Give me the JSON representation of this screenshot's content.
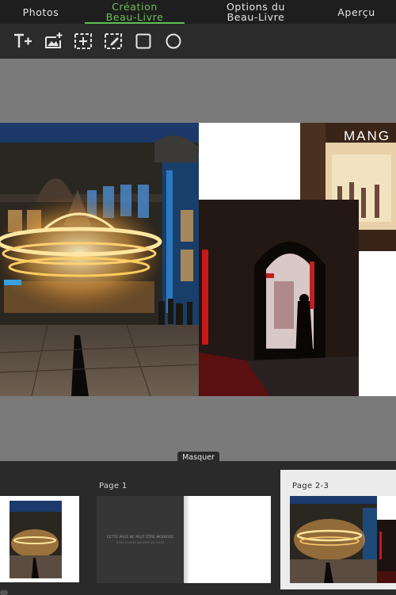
{
  "nav": {
    "tabs": [
      {
        "label": "Photos"
      },
      {
        "label": "Création\nBeau-Livre"
      },
      {
        "label": "Options du\nBeau-Livre"
      },
      {
        "label": "Aperçu"
      }
    ]
  },
  "toolbar": {
    "tools": [
      {
        "icon": "add-text-icon"
      },
      {
        "icon": "add-image-icon"
      },
      {
        "icon": "add-frame-icon"
      },
      {
        "icon": "edit-frame-icon"
      },
      {
        "icon": "square-icon"
      },
      {
        "icon": "circle-icon"
      }
    ]
  },
  "photos": {
    "mango_sign": "MANG"
  },
  "bottom": {
    "hide_label": "Masquer",
    "pages": [
      {
        "label": "Page 1",
        "cover_line1": "CETTE PAGE NE PEUT ÊTRE MODIFIÉE",
        "cover_line2": "VOUS POUVEZ AJOUTER UN TEXTE"
      },
      {
        "label": "Page 2-3"
      }
    ]
  },
  "colors": {
    "nav_bg": "#1e1e1e",
    "toolbar_bg": "#2b2b2b",
    "active_accent": "#5dc052",
    "workspace_bg": "#7a7a7a",
    "panel_bg": "#2a2a2a"
  }
}
